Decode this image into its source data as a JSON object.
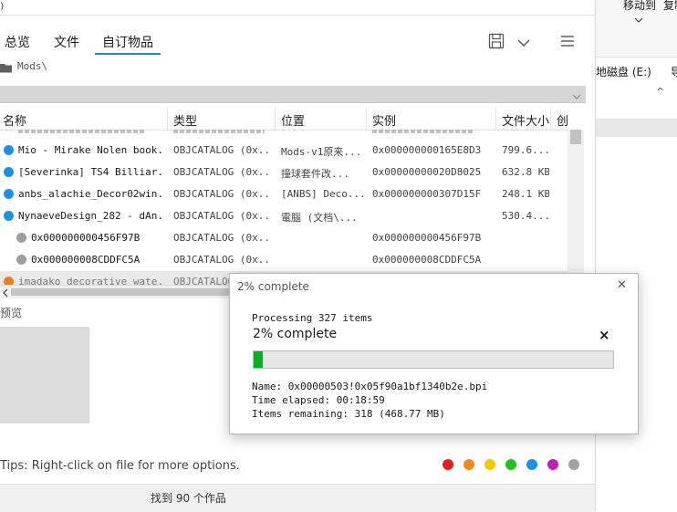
{
  "explorer": {
    "move_to_label": "移动到",
    "copy_label": "复制",
    "drive_label": "地磁盘 (E:)",
    "nav_glyph": "导",
    "up_arrow": "^"
  },
  "app": {
    "title_fragment": ")",
    "tabs": [
      {
        "label": "总览"
      },
      {
        "label": "文件"
      },
      {
        "label": "自订物品",
        "active": true
      }
    ],
    "toolbar_icons": [
      "save-icon",
      "chevron-down-icon",
      "hamburger-menu-icon"
    ],
    "path": "Mods\\",
    "columns": [
      "名称",
      "类型",
      "位置",
      "实例",
      "文件大小",
      "创"
    ],
    "rows": [
      {
        "name": "Mio - Mirake Nolen book...",
        "type": "OBJCATALOG (0x...",
        "location": "Mods-v1原来...",
        "instance": "0x000000000165E8D3",
        "size": "799.6...",
        "dot": "#1e90e0",
        "indent": false
      },
      {
        "name": "[Severinka] TS4 Billiar...",
        "type": "OBJCATALOG (0x...",
        "location": "撞球套件改...",
        "instance": "0x00000000020D8025",
        "size": "632.8 KB",
        "dot": "#1e90e0",
        "indent": false
      },
      {
        "name": "anbs_alachie_Decor02win...",
        "type": "OBJCATALOG (0x...",
        "location": "[ANBS] Deco...",
        "instance": "0x000000000307D15F",
        "size": "248.1 KB",
        "dot": "#1e90e0",
        "indent": false
      },
      {
        "name": "NynaeveDesign_282 - dAn...",
        "type": "OBJCATALOG (0x...",
        "location": "電腦 (文档\\...",
        "instance": "",
        "size": "530.4...",
        "dot": "#1e90e0",
        "indent": false
      },
      {
        "name": "0x000000000456F97B",
        "type": "OBJCATALOG (0x...",
        "location": "",
        "instance": "0x000000000456F97B",
        "size": "",
        "dot": "#9e9e9e",
        "indent": true
      },
      {
        "name": "0x000000008CDDFC5A",
        "type": "OBJCATALOG (0x...",
        "location": "",
        "instance": "0x000000008CDDFC5A",
        "size": "",
        "dot": "#9e9e9e",
        "indent": true
      },
      {
        "name": "imadako_decorative_wate...",
        "type": "OBJCATALOG",
        "location": "",
        "instance": "",
        "size": "",
        "dot": "#ef7d1a",
        "indent": false
      }
    ],
    "preview_label": "预览",
    "tips": "Tips:  Right-click on file for more options.",
    "color_filters": [
      "#e02020",
      "#f08a1c",
      "#f2c600",
      "#21c21d",
      "#1e90e0",
      "#c21fb4",
      "#a3a3a3"
    ],
    "status": "找到 90 个作品"
  },
  "dialog": {
    "title": "2% complete",
    "processing": "Processing 327 items",
    "percent_text": "2% complete",
    "progress": 0.025,
    "name_line": "Name: 0x00000503!0x05f90a1bf1340b2e.bpi",
    "elapsed_line": "Time elapsed: 00:18:59",
    "remaining_line": "Items remaining: 318 (468.77 MB)",
    "close_glyph": "✕",
    "cancel_glyph": "×"
  }
}
